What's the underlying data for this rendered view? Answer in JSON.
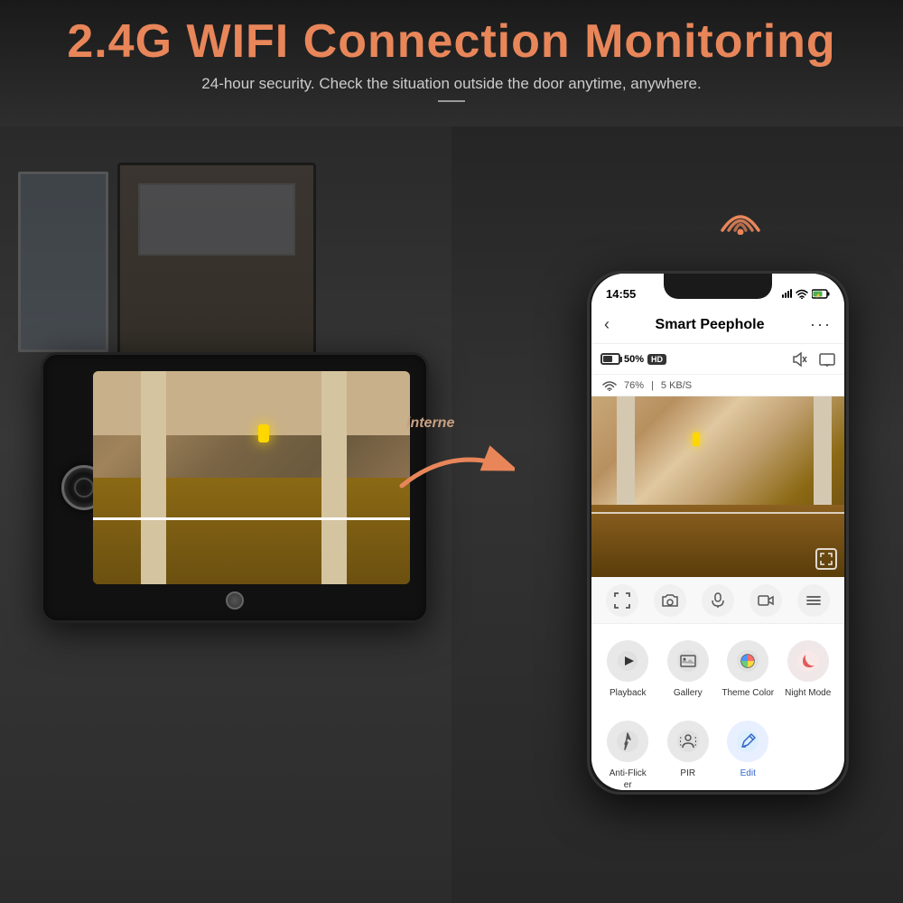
{
  "header": {
    "title": "2.4G WIFI Connection Monitoring",
    "subtitle": "24-hour security. Check the situation outside the door anytime, anywhere."
  },
  "internet_label": "interne",
  "phone": {
    "status_bar": {
      "time": "14:55",
      "signal": "signal",
      "wifi": "wifi",
      "battery": "battery"
    },
    "app_title": "Smart Peephole",
    "back_label": "‹",
    "more_label": "···",
    "battery_pct": "50%",
    "hd_label": "HD",
    "wifi_pct": "76%",
    "speed": "5 KB/S",
    "features": [
      {
        "label": "Playback",
        "color": "#e8e8e8",
        "icon": "▶"
      },
      {
        "label": "Gallery",
        "color": "#e8e8e8",
        "icon": "🖼"
      },
      {
        "label": "Theme Color",
        "color": "#e8e8e8",
        "icon": "🎨"
      },
      {
        "label": "Night Mode",
        "color": "#e8e8e8",
        "icon": "🌙"
      }
    ],
    "features2": [
      {
        "label": "Anti-Flicker",
        "color": "#e8e8e8",
        "icon": "⚡"
      },
      {
        "label": "PIR",
        "color": "#e8e8e8",
        "icon": "👤"
      },
      {
        "label": "Edit",
        "color": "#e8e8e8",
        "icon": "✏"
      }
    ]
  }
}
